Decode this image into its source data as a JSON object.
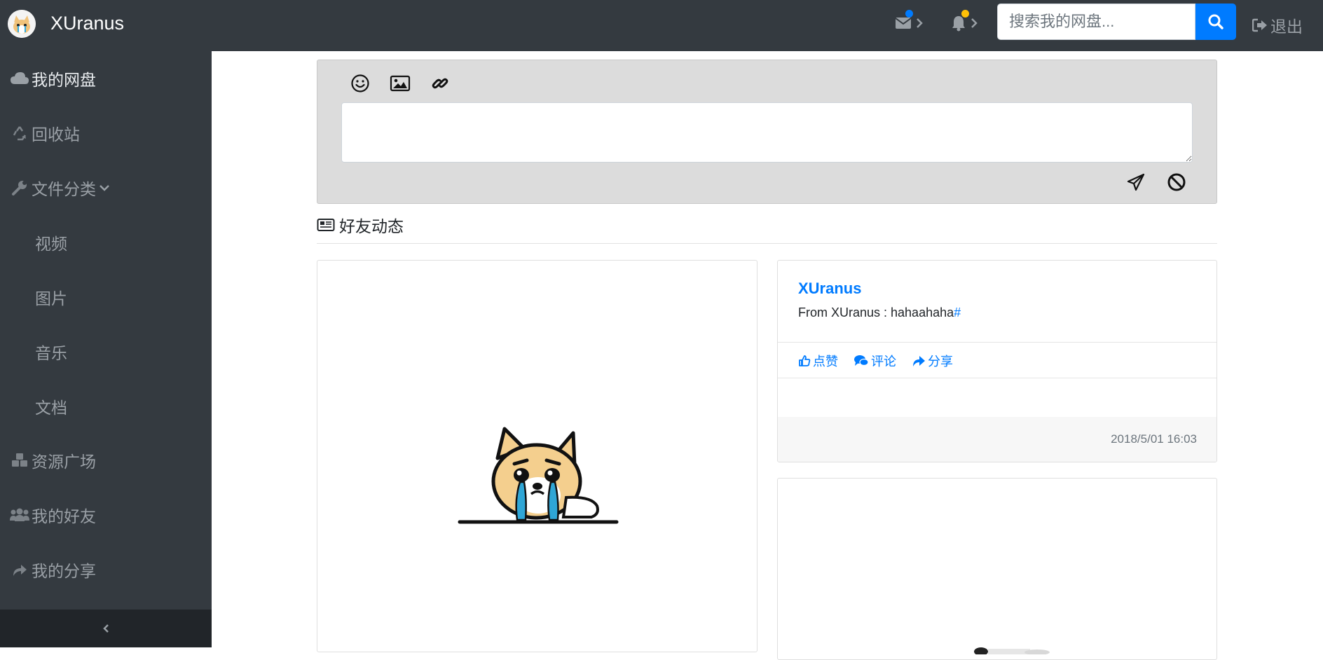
{
  "app": {
    "brand_name": "XUranus"
  },
  "topbar": {
    "search_placeholder": "搜索我的网盘...",
    "logout_label": "退出",
    "mail_dot_color": "#007bff",
    "bell_dot_color": "#ffc107"
  },
  "sidebar": {
    "items": [
      {
        "label": "我的网盘",
        "icon": "cloud-icon"
      },
      {
        "label": "回收站",
        "icon": "recycle-icon"
      },
      {
        "label": "文件分类",
        "icon": "wrench-icon"
      },
      {
        "label": "视频"
      },
      {
        "label": "图片"
      },
      {
        "label": "音乐"
      },
      {
        "label": "文档"
      },
      {
        "label": "资源广场",
        "icon": "cubes-icon"
      },
      {
        "label": "我的好友",
        "icon": "users-icon"
      },
      {
        "label": "我的分享",
        "icon": "share-icon"
      }
    ]
  },
  "feed": {
    "header": "好友动态",
    "post": {
      "author": "XUranus",
      "text": "From XUranus : hahaahaha",
      "hash": "#",
      "actions": {
        "like": "点赞",
        "comment": "评论",
        "share": "分享"
      },
      "time": "2018/5/01 16:03"
    }
  },
  "colors": {
    "topbar_bg": "#343a40",
    "sidebar_bg": "#343a40",
    "accent": "#007bff",
    "composer_bg": "#dcdcdc"
  }
}
